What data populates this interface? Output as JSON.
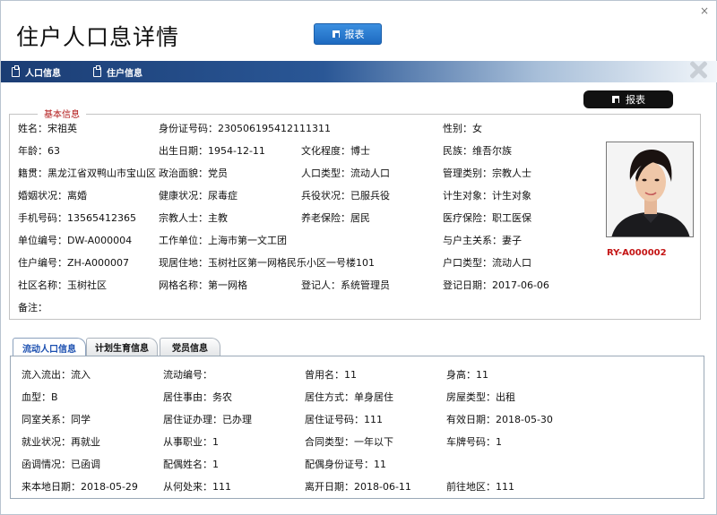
{
  "window": {
    "title": "住户人口息详情",
    "close_label": "×"
  },
  "toolbar": {
    "report_label": "报表"
  },
  "nav": {
    "items": [
      {
        "label": "人口信息"
      },
      {
        "label": "住户信息"
      }
    ]
  },
  "basic": {
    "legend": "基本信息",
    "report_label": "报表",
    "fields": [
      "姓名：宋祖英",
      "身份证号码：230506195412111311",
      "性别：女",
      "年龄：63",
      "出生日期：1954-12-11",
      "文化程度：博士",
      "民族：维吾尔族",
      "籍贯：黑龙江省双鸭山市宝山区",
      "政治面貌：党员",
      "人口类型：流动人口",
      "管理类别：宗教人士",
      "婚姻状况：离婚",
      "健康状况：尿毒症",
      "兵役状况：已服兵役",
      "计生对象：计生对象",
      "手机号码：13565412365",
      "宗教人士：主教",
      "养老保险：居民",
      "医疗保险：职工医保",
      "单位编号：DW-A000004",
      "工作单位：上海市第一文工团",
      "与户主关系：妻子",
      "住户编号：ZH-A000007",
      "现居住地：玉树社区第一网格民乐小区一号楼101",
      "户口类型：流动人口",
      "社区名称：玉树社区",
      "网格名称：第一网格",
      "登记人：系统管理员",
      "登记日期：2017-06-06",
      "备注："
    ],
    "photo_id": "RY-A000002"
  },
  "tabs": [
    {
      "label": "流动人口信息"
    },
    {
      "label": "计划生育信息"
    },
    {
      "label": "党员信息"
    }
  ],
  "flow": {
    "fields": [
      "流入流出：流入",
      "流动编号：",
      "曾用名：11",
      "身高：11",
      "血型：B",
      "居住事由：务农",
      "居住方式：单身居住",
      "房屋类型：出租",
      "同室关系：同学",
      "居住证办理：已办理",
      "居住证号码：111",
      "有效日期：2018-05-30",
      "就业状况：再就业",
      "从事职业：1",
      "合同类型：一年以下",
      "车牌号码：1",
      "函调情况：已函调",
      "配偶姓名：1",
      "配偶身份证号：11",
      "来本地日期：2018-05-29",
      "从何处来：111",
      "离开日期：2018-06-11",
      "前往地区：111"
    ]
  }
}
